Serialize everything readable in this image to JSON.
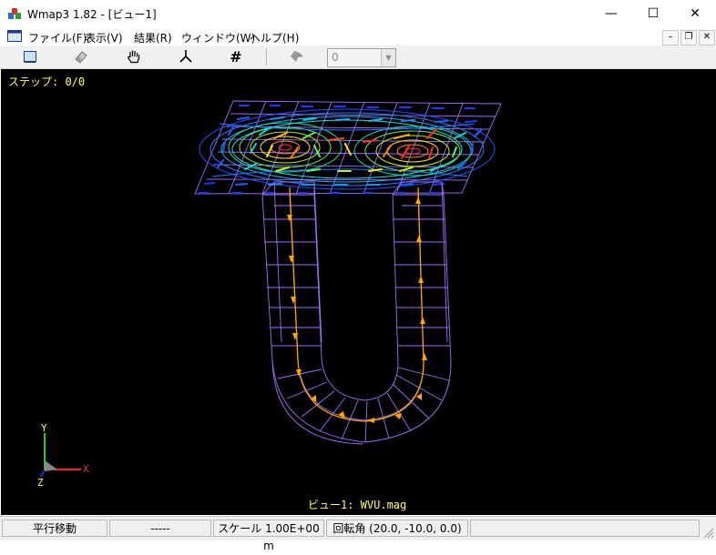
{
  "window": {
    "title": "Wmap3 1.82 - [ビュー1]",
    "minimize": "—",
    "maximize": "☐",
    "close": "✕"
  },
  "menu": {
    "items": [
      "ファイル(F)",
      "表示(V)",
      "結果(R)",
      "ウィンドウ(W)",
      "ヘルプ(H)"
    ],
    "mdi_minimize": "–",
    "mdi_restore": "❐",
    "mdi_close": "✕"
  },
  "toolbar": {
    "grid_label": "#",
    "combo_value": "0"
  },
  "viewport": {
    "step_text": "ステップ: 0/0",
    "view_label": "ビュー1: WVU.mag",
    "axis_y": "Y",
    "axis_x": "X",
    "axis_z": "Z",
    "background": "#000000",
    "mesh_color": "#a070ff",
    "flow_color": "#ffa500"
  },
  "status": {
    "mode": "平行移動",
    "value": "-----",
    "scale": "スケール 1.00E+00 m",
    "rotation": "回転角 (20.0, -10.0, 0.0)"
  }
}
